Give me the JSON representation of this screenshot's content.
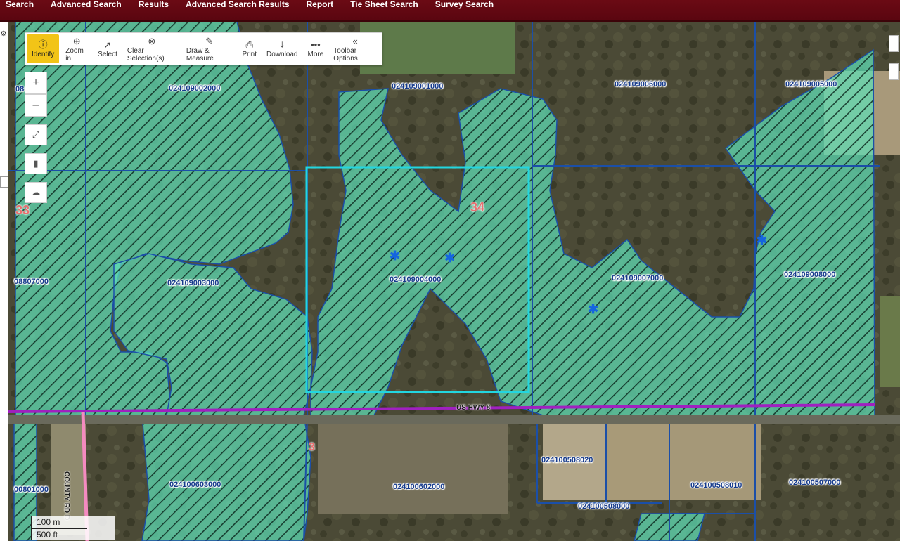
{
  "nav": {
    "items": [
      "Search",
      "Advanced Search",
      "Results",
      "Advanced Search Results",
      "Report",
      "Tie Sheet Search",
      "Survey Search"
    ]
  },
  "toolbar": {
    "identify": "Identify",
    "zoom_in": "Zoom in",
    "select": "Select",
    "clear_selections": "Clear Selection(s)",
    "draw_measure": "Draw & Measure",
    "print": "Print",
    "download": "Download",
    "more": "More",
    "toolbar_options": "Toolbar Options"
  },
  "zoom": {
    "in": "+",
    "out": "–"
  },
  "sections": {
    "s33": "33",
    "s34": "34",
    "s3": "3"
  },
  "roads": {
    "us_hwy_8": "US HWY 8",
    "county_rd_d": "COUNTY RD D"
  },
  "parcels": {
    "p1": "024109002000",
    "p2": "024109001000",
    "p3": "024109006000",
    "p4": "024109005000",
    "p5": "024109003000",
    "p6": "024109004000",
    "p7": "024109007000",
    "p8": "024109008000",
    "p9": "024100603000",
    "p10": "024100602000",
    "p11": "024100508020",
    "p12": "024100508000",
    "p13": "024100508010",
    "p14": "024100507000",
    "p15": "08807000",
    "p16": "00801000",
    "p17": "08"
  },
  "scale": {
    "metric": "100 m",
    "imperial": "500 ft"
  },
  "colors": {
    "nav_bg": "#5e0812",
    "wetland_fill": "#5fe0b8",
    "parcel_line": "#1b4fa8",
    "selection": "#22d6e0",
    "highway": "#a020c0",
    "county_road": "#f48ac0",
    "toolbar_active": "#f2c417"
  },
  "icons": [
    "info-icon",
    "zoom-in-icon",
    "pointer-icon",
    "clear-icon",
    "pencil-icon",
    "print-icon",
    "download-icon",
    "more-icon",
    "collapse-icon",
    "fullscreen-icon",
    "bookmark-icon",
    "cloud-icon",
    "marker-icon"
  ]
}
